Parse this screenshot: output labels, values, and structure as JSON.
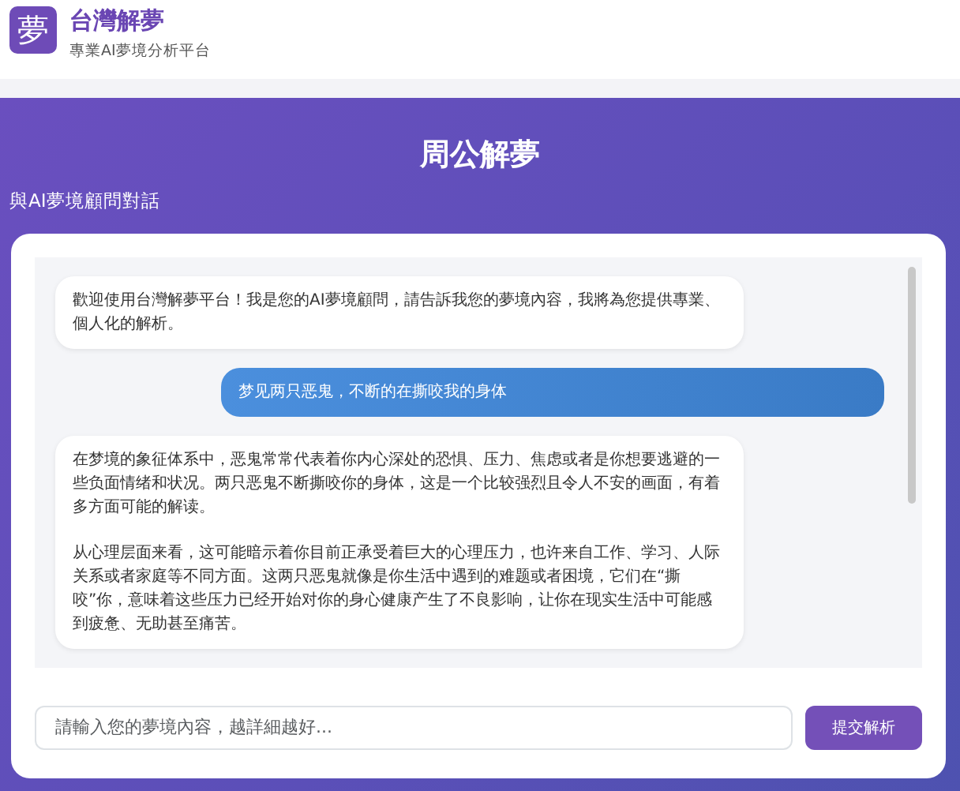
{
  "header": {
    "logo": "夢",
    "title": "台灣解夢",
    "subtitle": "專業AI夢境分析平台"
  },
  "hero": {
    "title": "周公解夢",
    "subtitle": "與AI夢境顧問對話"
  },
  "messages": [
    {
      "kind": "bot",
      "paragraphs": [
        "歡迎使用台灣解夢平台！我是您的AI夢境顧問，請告訴我您的夢境內容，我將為您提供專業、個人化的解析。"
      ]
    },
    {
      "kind": "user",
      "paragraphs": [
        "梦见两只恶鬼，不断的在撕咬我的身体"
      ]
    },
    {
      "kind": "bot",
      "paragraphs": [
        "在梦境的象征体系中，恶鬼常常代表着你内心深处的恐惧、压力、焦虑或者是你想要逃避的一些负面情绪和状况。两只恶鬼不断撕咬你的身体，这是一个比较强烈且令人不安的画面，有着多方面可能的解读。",
        "从心理层面来看，这可能暗示着你目前正承受着巨大的心理压力，也许来自工作、学习、人际关系或者家庭等不同方面。这两只恶鬼就像是你生活中遇到的难题或者困境，它们在“撕咬”你，意味着这些压力已经开始对你的身心健康产生了不良影响，让你在现实生活中可能感到疲惫、无助甚至痛苦。"
      ]
    }
  ],
  "input": {
    "placeholder": "請輸入您的夢境內容，越詳細越好..."
  },
  "submit_button": "提交解析"
}
